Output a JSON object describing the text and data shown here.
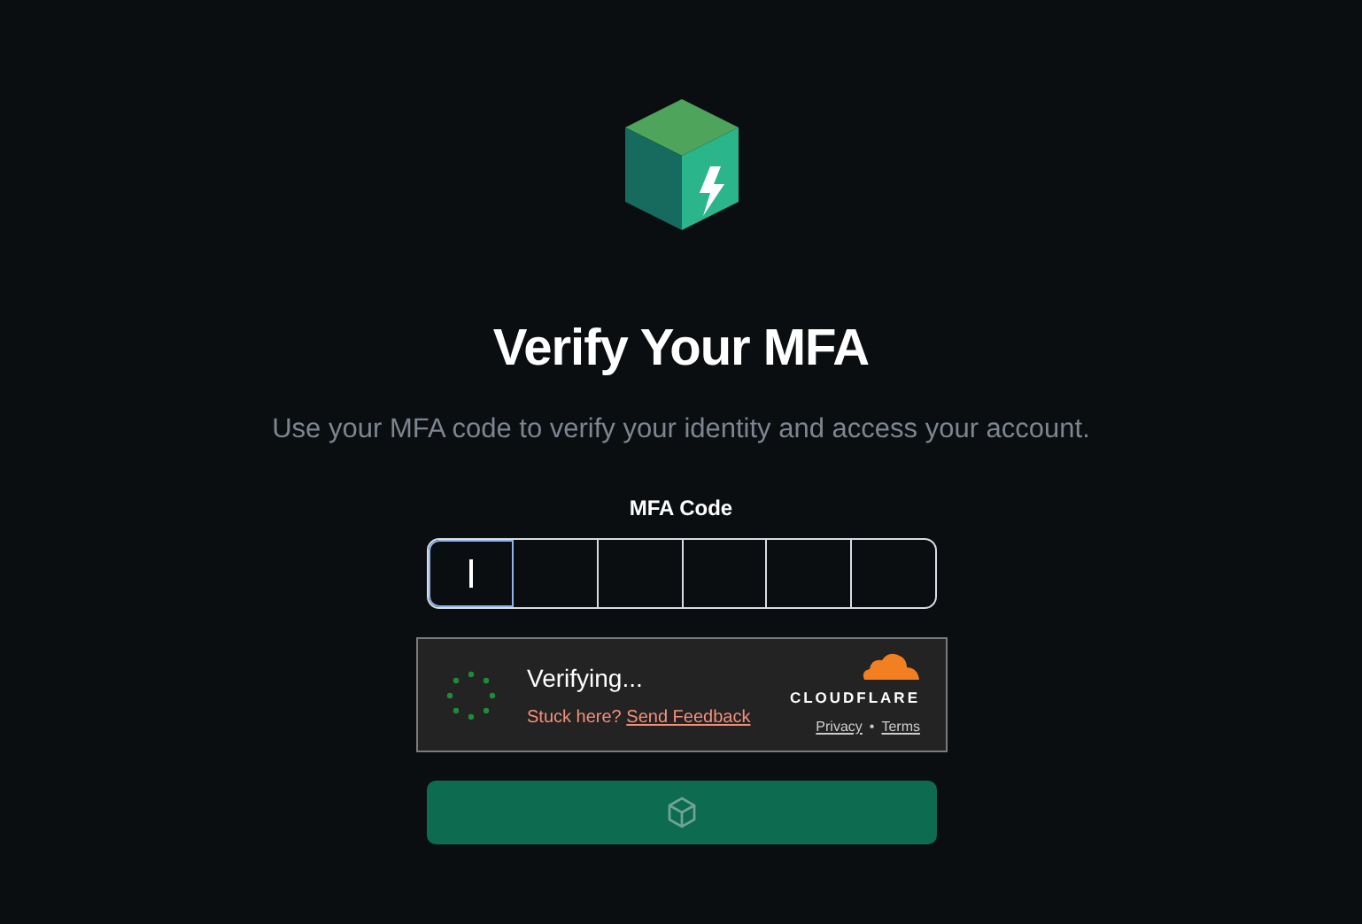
{
  "title": "Verify Your MFA",
  "subtitle": "Use your MFA code to verify your identity and access your account.",
  "mfa_code": {
    "label": "MFA Code",
    "digits": [
      {
        "selected": true
      },
      {
        "selected": false
      },
      {
        "selected": false
      },
      {
        "selected": false
      },
      {
        "selected": false
      },
      {
        "selected": false
      }
    ]
  },
  "captcha": {
    "status": "Verifying...",
    "stuck": "Stuck here?",
    "feedback_link": "Send Feedback",
    "brand": "CLOUDFLARE",
    "privacy": "Privacy",
    "separator": "•",
    "terms": "Terms"
  }
}
